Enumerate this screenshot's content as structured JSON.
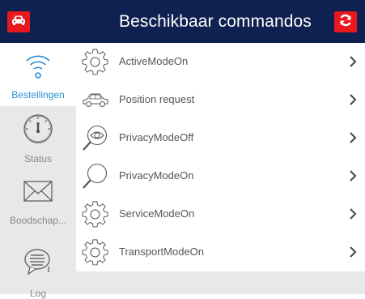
{
  "header": {
    "title": "Beschikbaar commandos",
    "left_icon": "car-icon",
    "right_icon": "refresh-icon",
    "accent_color": "#e8191e",
    "bar_color": "#0e2150"
  },
  "sidebar": {
    "items": [
      {
        "label": "Bestellingen",
        "icon": "wifi-icon",
        "active": true
      },
      {
        "label": "Status",
        "icon": "gauge-icon",
        "active": false
      },
      {
        "label": "Boodschap...",
        "icon": "envelope-icon",
        "active": false
      },
      {
        "label": "Log",
        "icon": "chat-bubble-icon",
        "active": false
      }
    ],
    "active_color": "#2a8fd6"
  },
  "commands": [
    {
      "label": "ActiveModeOn",
      "icon": "gear-icon"
    },
    {
      "label": "Position request",
      "icon": "car-outline-icon"
    },
    {
      "label": "PrivacyModeOff",
      "icon": "eye-magnifier-icon"
    },
    {
      "label": "PrivacyModeOn",
      "icon": "magnifier-icon"
    },
    {
      "label": "ServiceModeOn",
      "icon": "gear-icon"
    },
    {
      "label": "TransportModeOn",
      "icon": "gear-icon"
    }
  ]
}
